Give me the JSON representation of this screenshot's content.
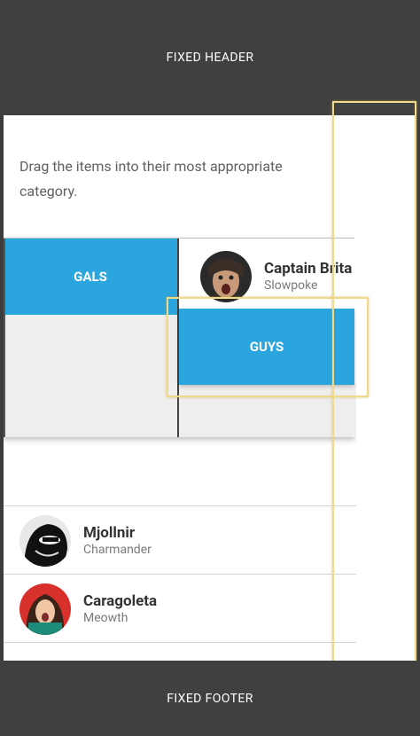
{
  "header": {
    "title": "FIXED HEADER"
  },
  "footer": {
    "title": "FIXED FOOTER"
  },
  "instructions": {
    "line1": "Drag the items into their most appropriate",
    "line2": "category."
  },
  "categories": {
    "gals": "GALS",
    "guys": "GUYS"
  },
  "board_item": {
    "name": "Captain Brita",
    "subtitle": "Slowpoke"
  },
  "list_items": [
    {
      "name": "Mjollnir",
      "subtitle": "Charmander"
    },
    {
      "name": "Caragoleta",
      "subtitle": "Meowth"
    }
  ],
  "colors": {
    "category_blue": "#2ba5de",
    "chrome": "#404040",
    "highlight": "#f0d98a"
  }
}
